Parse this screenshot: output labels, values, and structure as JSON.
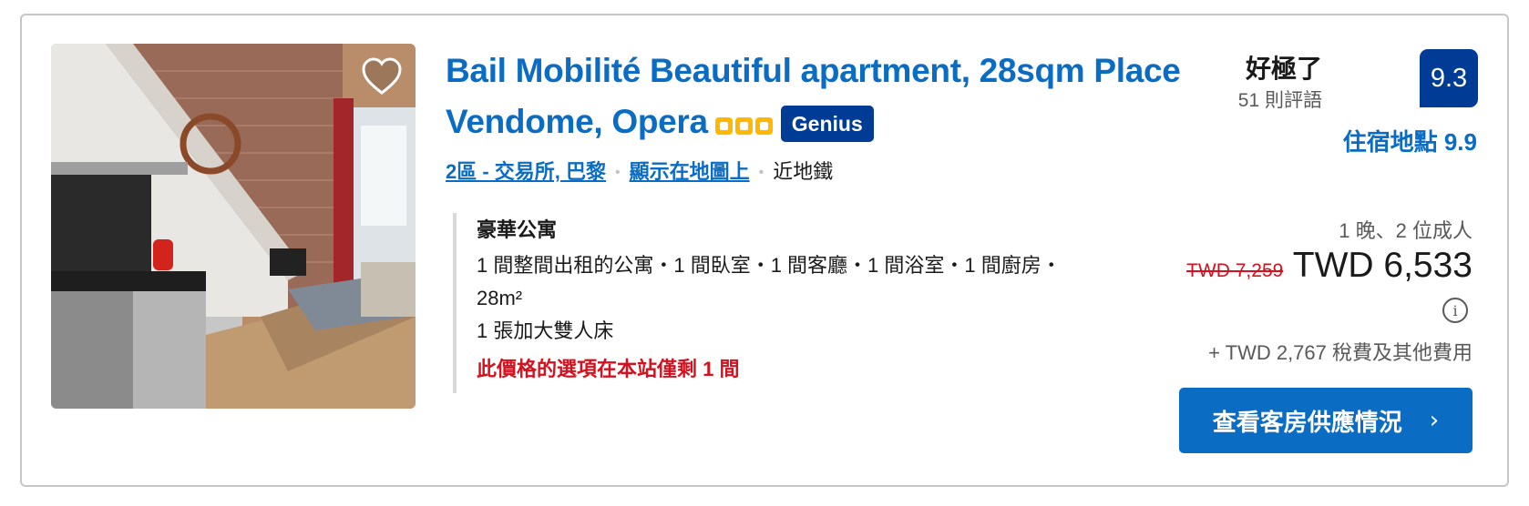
{
  "property": {
    "title": "Bail Mobilité Beautiful apartment, 28sqm Place Vendome, Opera",
    "stars": 3,
    "genius_label": "Genius",
    "district_link": "2區 - 交易所, 巴黎",
    "map_link": "顯示在地圖上",
    "metro_label": "近地鐵"
  },
  "rating": {
    "word": "好極了",
    "reviews": "51 則評語",
    "score": "9.3",
    "location_score": "住宿地點 9.9"
  },
  "room": {
    "name": "豪華公寓",
    "detail": "1 間整間出租的公寓・1 間臥室・1 間客廳・1 間浴室・1 間廚房・28m²",
    "bed": "1 張加大雙人床",
    "urgency": "此價格的選項在本站僅剩 1 間"
  },
  "pricing": {
    "occupancy": "1 晚、2 位成人",
    "original_price": "TWD 7,259",
    "price": "TWD 6,533",
    "info_icon": "i",
    "taxes": "+ TWD 2,767 稅費及其他費用"
  },
  "cta": {
    "label": "查看客房供應情況",
    "chevron": "›"
  },
  "icons": {
    "favorite": "heart-outline-icon",
    "info": "info-circle-icon",
    "star": "square-star-icon"
  },
  "colors": {
    "link_blue": "#0b6cc4",
    "dark_blue": "#003b95",
    "star_yellow": "#ffb700",
    "alert_red": "#d4111e"
  }
}
